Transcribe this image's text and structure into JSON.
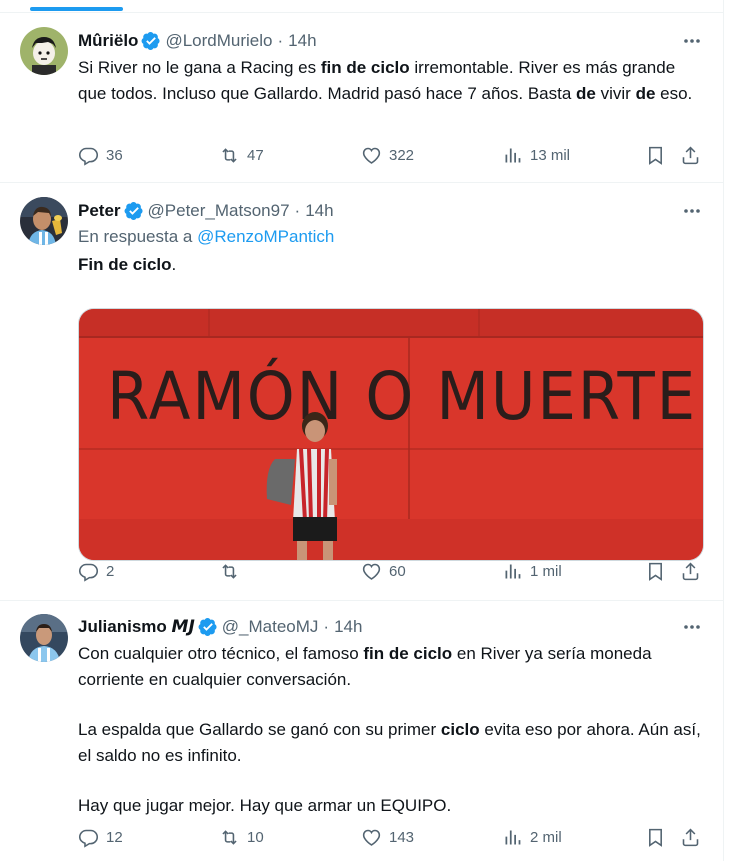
{
  "tweets": [
    {
      "display_name": "Mûriëlo",
      "handle": "@LordMurielo",
      "separator": "·",
      "time": "14h",
      "text_segments": [
        {
          "t": "Si River no le gana a Racing es ",
          "b": false
        },
        {
          "t": "fin de ciclo",
          "b": true
        },
        {
          "t": " irremontable. River es más grande que todos. Incluso que Gallardo. Madrid pasó hace 7 años. Basta ",
          "b": false
        },
        {
          "t": "de",
          "b": true
        },
        {
          "t": " vivir ",
          "b": false
        },
        {
          "t": "de",
          "b": true
        },
        {
          "t": " eso.",
          "b": false
        }
      ],
      "replies": "36",
      "retweets": "47",
      "likes": "322",
      "views": "13 mil"
    },
    {
      "display_name": "Peter",
      "handle": "@Peter_Matson97",
      "separator": "·",
      "time": "14h",
      "reply_prefix": "En respuesta a",
      "reply_to": "@RenzoMPantich",
      "text_segments": [
        {
          "t": "Fin de ciclo",
          "b": true
        },
        {
          "t": ".",
          "b": false
        }
      ],
      "media_text": "RAMÓN O MUERTE",
      "replies": "2",
      "retweets": "",
      "likes": "60",
      "views": "1 mil"
    },
    {
      "display_name": "Julianismo 𝙈𝙅",
      "handle": "@_MateoMJ",
      "separator": "·",
      "time": "14h",
      "paragraphs": [
        [
          {
            "t": "Con cualquier otro técnico, el famoso ",
            "b": false
          },
          {
            "t": "fin de ciclo",
            "b": true
          },
          {
            "t": " en River ya sería moneda corriente en cualquier conversación.",
            "b": false
          }
        ],
        [
          {
            "t": "La espalda que Gallardo se ganó con su primer ",
            "b": false
          },
          {
            "t": "ciclo",
            "b": true
          },
          {
            "t": " evita eso por ahora. Aún así, el saldo no es infinito.",
            "b": false
          }
        ],
        [
          {
            "t": "Hay que jugar mejor. Hay que armar un EQUIPO.",
            "b": false
          }
        ]
      ],
      "replies": "12",
      "retweets": "10",
      "likes": "143",
      "views": "2 mil"
    }
  ],
  "colors": {
    "accent": "#1d9bf0",
    "text": "#0f1419",
    "secondary": "#536471",
    "wall": "#d9362b"
  }
}
